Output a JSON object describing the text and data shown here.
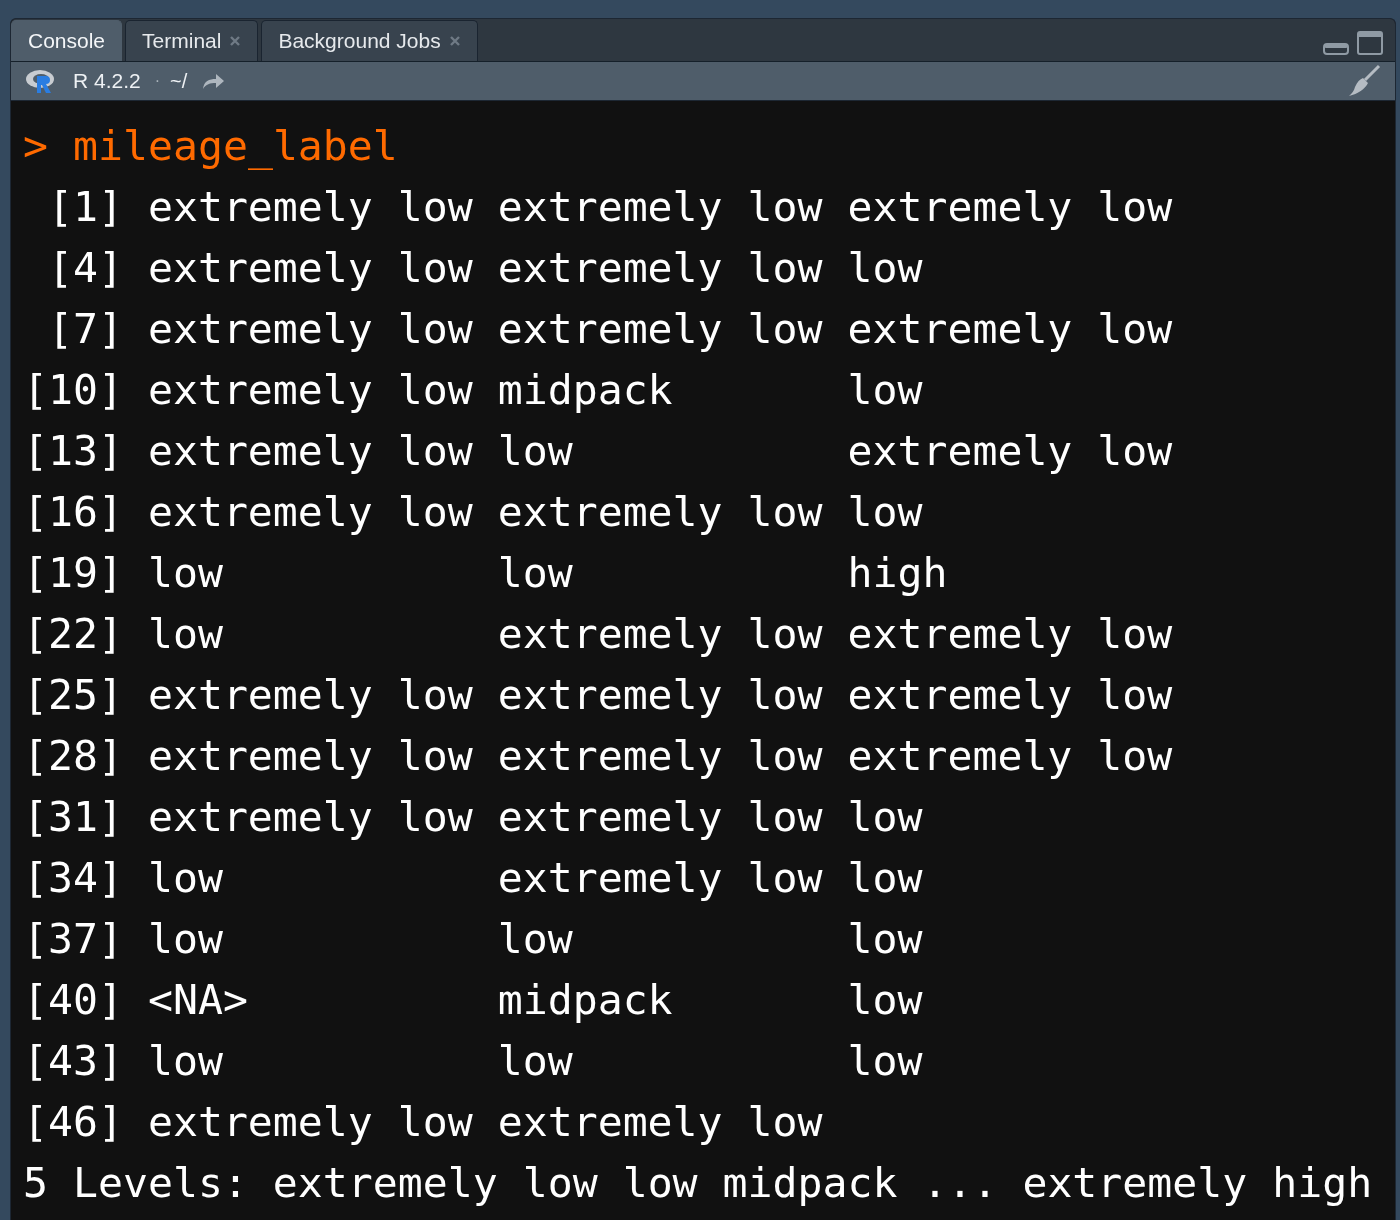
{
  "tabs": [
    {
      "label": "Console",
      "selected": true,
      "closable": false
    },
    {
      "label": "Terminal",
      "selected": false,
      "closable": true
    },
    {
      "label": "Background Jobs",
      "selected": false,
      "closable": true
    }
  ],
  "toolbar": {
    "version": "R 4.2.2",
    "separator": "·",
    "path": "~/"
  },
  "console": {
    "prompt": ">",
    "command": "mileage_label",
    "rows": [
      {
        "index": "[1]",
        "values": [
          "extremely low",
          "extremely low",
          "extremely low"
        ]
      },
      {
        "index": "[4]",
        "values": [
          "extremely low",
          "extremely low",
          "low"
        ]
      },
      {
        "index": "[7]",
        "values": [
          "extremely low",
          "extremely low",
          "extremely low"
        ]
      },
      {
        "index": "[10]",
        "values": [
          "extremely low",
          "midpack",
          "low"
        ]
      },
      {
        "index": "[13]",
        "values": [
          "extremely low",
          "low",
          "extremely low"
        ]
      },
      {
        "index": "[16]",
        "values": [
          "extremely low",
          "extremely low",
          "low"
        ]
      },
      {
        "index": "[19]",
        "values": [
          "low",
          "low",
          "high"
        ]
      },
      {
        "index": "[22]",
        "values": [
          "low",
          "extremely low",
          "extremely low"
        ]
      },
      {
        "index": "[25]",
        "values": [
          "extremely low",
          "extremely low",
          "extremely low"
        ]
      },
      {
        "index": "[28]",
        "values": [
          "extremely low",
          "extremely low",
          "extremely low"
        ]
      },
      {
        "index": "[31]",
        "values": [
          "extremely low",
          "extremely low",
          "low"
        ]
      },
      {
        "index": "[34]",
        "values": [
          "low",
          "extremely low",
          "low"
        ]
      },
      {
        "index": "[37]",
        "values": [
          "low",
          "low",
          "low"
        ]
      },
      {
        "index": "[40]",
        "values": [
          "<NA>",
          "midpack",
          "low"
        ]
      },
      {
        "index": "[43]",
        "values": [
          "low",
          "low",
          "low"
        ]
      },
      {
        "index": "[46]",
        "values": [
          "extremely low",
          "extremely low"
        ]
      }
    ],
    "levels": "5 Levels: extremely low low midpack ... extremely high"
  }
}
